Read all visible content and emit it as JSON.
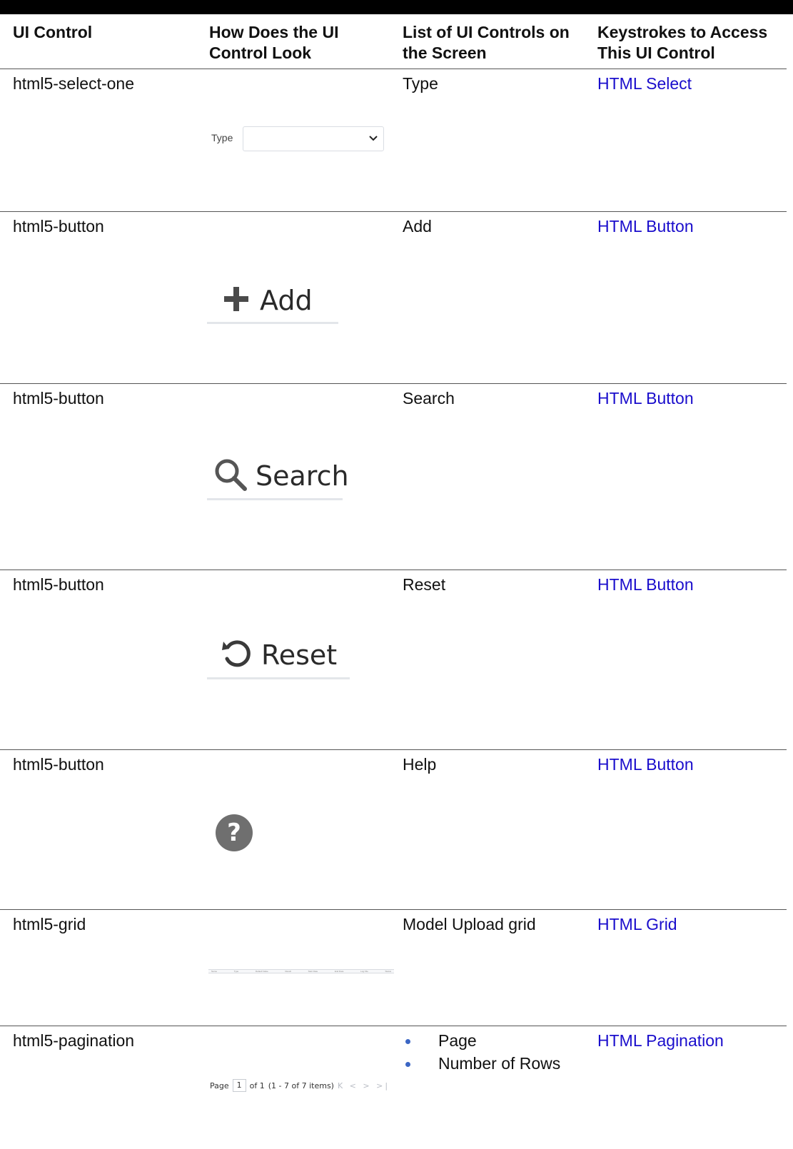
{
  "headers": {
    "col1": "UI Control",
    "col2_l1": "How Does the UI",
    "col2_l2": "Control Look",
    "col3_l1": "List of UI Controls on",
    "col3_l2": "the Screen",
    "col4_l1": "Keystrokes to Access",
    "col4_l2": "This UI Control"
  },
  "rows": [
    {
      "control": "html5-select-one",
      "screen_item": "Type",
      "keystroke": "HTML Select"
    },
    {
      "control": "html5-button",
      "screen_item": "Add",
      "keystroke": "HTML Button"
    },
    {
      "control": "html5-button",
      "screen_item": "Search",
      "keystroke": "HTML Button"
    },
    {
      "control": "html5-button",
      "screen_item": "Reset",
      "keystroke": "HTML Button"
    },
    {
      "control": "html5-button",
      "screen_item": "Help",
      "keystroke": "HTML Button"
    },
    {
      "control": "html5-grid",
      "screen_item": "Model Upload grid",
      "keystroke": "HTML Grid"
    },
    {
      "control": "html5-pagination",
      "screen_items": [
        "Page",
        "Number of Rows"
      ],
      "keystroke": "HTML Pagination"
    }
  ],
  "shots": {
    "select_label": "Type",
    "add_label": "Add",
    "search_label": "Search",
    "reset_label": "Reset",
    "help_glyph": "?",
    "grid_columns": [
      "Name",
      "Type",
      "Default Value",
      "Result",
      "Start Date",
      "End Date",
      "Log File",
      "Status"
    ],
    "pager": {
      "page_label": "Page",
      "page_value": "1",
      "of_text": "of 1",
      "range_text": "(1 - 7 of 7 items)",
      "nav": "K < > >|"
    }
  },
  "colors": {
    "link": "#1a0dcc",
    "bullet": "#3b66c4",
    "top_bar": "#000000"
  }
}
